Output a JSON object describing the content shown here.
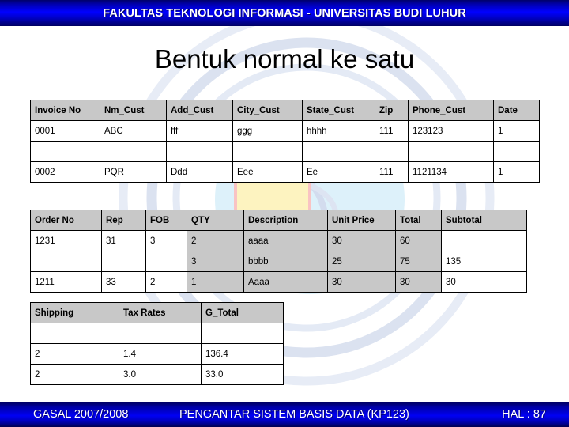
{
  "header": {
    "title": "FAKULTAS TEKNOLOGI INFORMASI - UNIVERSITAS BUDI LUHUR"
  },
  "slide": {
    "title": "Bentuk normal ke satu"
  },
  "footer": {
    "term": "GASAL 2007/2008",
    "course": "PENGANTAR SISTEM BASIS DATA (KP123)",
    "page": "HAL : 87"
  },
  "colors": {
    "bar_blue": "#0000ff",
    "bar_dark": "#000060",
    "header_cell": "#c8c8c8",
    "shaded_cell": "#c8c8c8",
    "watermark_blue": "#d7e0ef",
    "watermark_circle": "#d7f0fa",
    "watermark_yellow": "#fdf3c0",
    "watermark_pink": "#f9c9c9"
  },
  "tables": {
    "invoice": {
      "headers": [
        "Invoice No",
        "Nm_Cust",
        "Add_Cust",
        "City_Cust",
        "State_Cust",
        "Zip",
        "Phone_Cust",
        "Date"
      ],
      "rows": [
        [
          "0001",
          "ABC",
          "fff",
          "ggg",
          "hhhh",
          "111",
          "123123",
          "1"
        ],
        [
          "",
          "",
          "",
          "",
          "",
          "",
          "",
          ""
        ],
        [
          "0002",
          "PQR",
          "Ddd",
          "Eee",
          "Ee",
          "111",
          "1121134",
          "1"
        ]
      ]
    },
    "order": {
      "headers": [
        "Order No",
        "Rep",
        "FOB",
        "QTY",
        "Description",
        "Unit Price",
        "Total",
        "Subtotal"
      ],
      "rows": [
        [
          "1231",
          "31",
          "3",
          "2",
          "aaaa",
          "30",
          "60",
          ""
        ],
        [
          "",
          "",
          "",
          "3",
          "bbbb",
          "25",
          "75",
          "135"
        ],
        [
          "1211",
          "33",
          "2",
          "1",
          "Aaaa",
          "30",
          "30",
          "30"
        ]
      ],
      "shaded_columns": [
        3,
        4,
        5,
        6
      ]
    },
    "totals": {
      "headers": [
        "Shipping",
        "Tax Rates",
        "G_Total"
      ],
      "rows": [
        [
          "",
          "",
          ""
        ],
        [
          "2",
          "1.4",
          "136.4"
        ],
        [
          "2",
          "3.0",
          "33.0"
        ]
      ]
    }
  }
}
